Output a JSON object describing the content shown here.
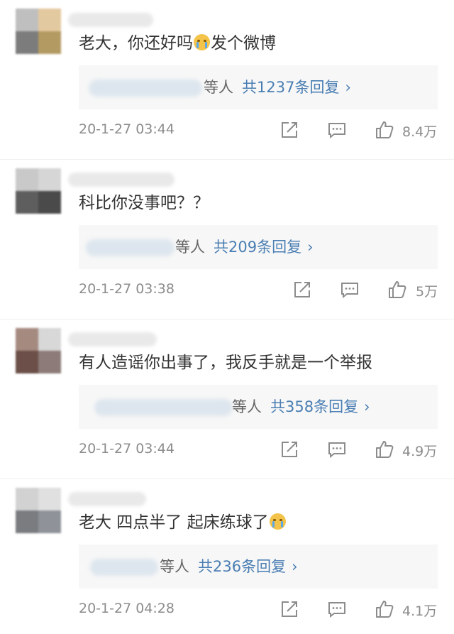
{
  "comments": [
    {
      "text": "老大，你还好吗",
      "emoji_name": "crying-emoji",
      "text_after": "发个微博",
      "reply_who": "等人",
      "reply_count": "共1237条回复",
      "reply_arrow": "›",
      "time": "20-1-27 03:44",
      "likes": "8.4万",
      "avatar_colors": [
        "#bfbfbf",
        "#e3c9a0",
        "#7c7c7c",
        "#b39a62"
      ]
    },
    {
      "text": "科比你没事吧？？",
      "reply_who": "等人",
      "reply_count": "共209条回复",
      "reply_arrow": "›",
      "time": "20-1-27 03:38",
      "likes": "5万",
      "avatar_colors": [
        "#c9c9c9",
        "#d6d6d6",
        "#5e5e5e",
        "#4a4a4a"
      ]
    },
    {
      "text": "有人造谣你出事了，我反手就是一个举报",
      "reply_who": "等人",
      "reply_count": "共358条回复",
      "reply_arrow": "›",
      "time": "20-1-27 03:44",
      "likes": "4.9万",
      "avatar_colors": [
        "#a58a80",
        "#d8d8d8",
        "#6b4f48",
        "#8c7b78"
      ]
    },
    {
      "text": "老大 四点半了 起床练球了",
      "emoji_name": "crying-emoji",
      "text_after": "",
      "reply_who": "等人",
      "reply_count": "共236条回复",
      "reply_arrow": "›",
      "time": "20-1-27 04:28",
      "likes": "4.1万",
      "avatar_colors": [
        "#d2d2d2",
        "#e0e0e0",
        "#7a7c80",
        "#8f9399"
      ]
    }
  ],
  "icons": {
    "share": "share-icon",
    "comment": "comment-icon",
    "like": "thumbs-up-icon"
  },
  "colors": {
    "link": "#4a7eb3",
    "meta": "#8c8c8c",
    "reply_bg": "#f7f7f7"
  }
}
